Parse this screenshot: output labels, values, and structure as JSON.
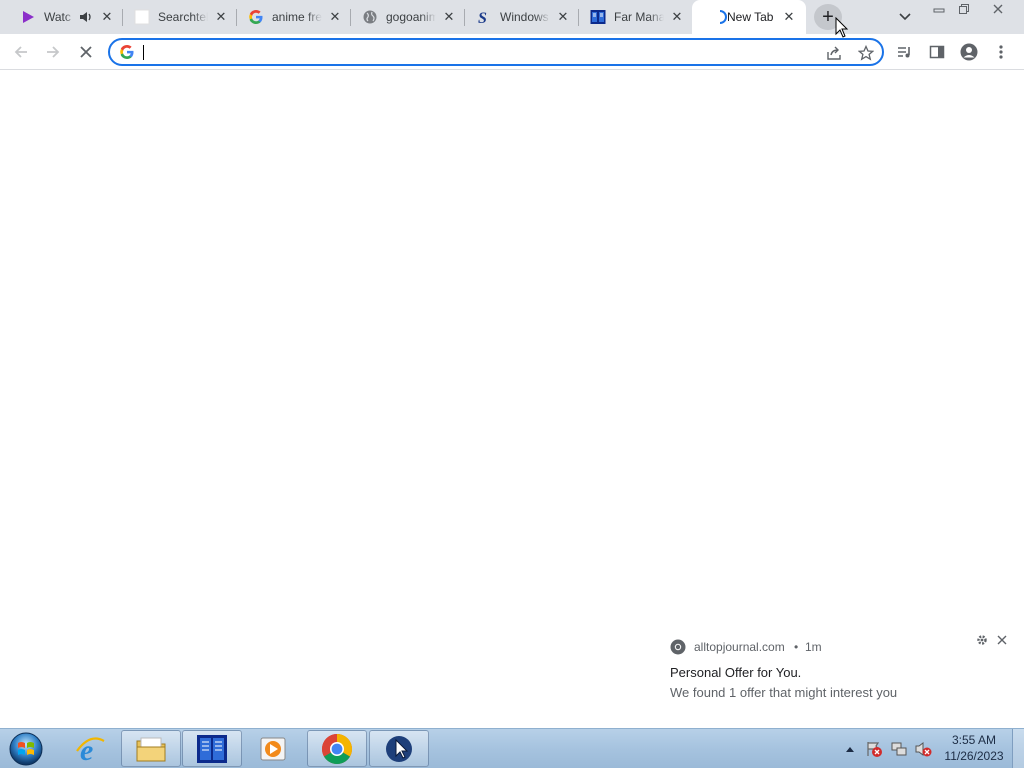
{
  "browser": {
    "tabs": [
      {
        "title": "Watc",
        "icon": "play-icon",
        "muted_icon": "speaker-icon",
        "active": false
      },
      {
        "title": "Searchtel",
        "icon": "blank-page-icon",
        "active": false
      },
      {
        "title": "anime fre",
        "icon": "google-icon",
        "active": false
      },
      {
        "title": "gogoanim",
        "icon": "globe-icon",
        "active": false
      },
      {
        "title": "Windows",
        "icon": "s-logo-icon",
        "active": false
      },
      {
        "title": "Far Mana",
        "icon": "far-manager-icon",
        "active": false
      },
      {
        "title": "New Tab",
        "icon": "loading-spinner-icon",
        "active": true
      }
    ],
    "close_glyph": "✕",
    "new_tab_glyph": "+",
    "tab_search_glyph": "⌄",
    "window_controls": {
      "minimize": "–",
      "restore": "❐",
      "close": "✕"
    }
  },
  "toolbar": {
    "back_icon": "back-arrow-icon",
    "forward_icon": "forward-arrow-icon",
    "stop_glyph": "✕",
    "address": {
      "value": "",
      "placeholder": ""
    }
  },
  "notification": {
    "site": "alltopjournal.com",
    "separator": "•",
    "time": "1m",
    "title": "Personal Offer for You.",
    "body": "We found 1 offer that might interest you"
  },
  "taskbar": {
    "pinned": [
      {
        "name": "internet-explorer",
        "running": false
      },
      {
        "name": "file-explorer",
        "running": true
      },
      {
        "name": "far-manager",
        "running": true
      },
      {
        "name": "media-player",
        "running": false
      },
      {
        "name": "chrome",
        "running": true
      },
      {
        "name": "cursor-app",
        "running": true
      }
    ],
    "clock": {
      "time": "3:55 AM",
      "date": "11/26/2023"
    }
  },
  "colors": {
    "tabstrip": "#dee1e6",
    "accent": "#1a73e8",
    "taskbar": "#a6c3df"
  }
}
